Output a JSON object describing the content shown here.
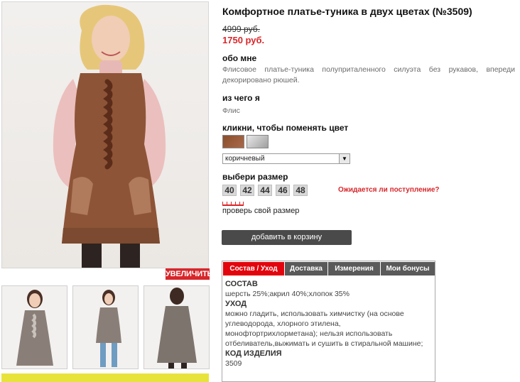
{
  "product": {
    "title": "Комфортное платье-туника в двух цветах (№3509)",
    "old_price": "4999 руб.",
    "new_price": "1750 руб."
  },
  "gallery": {
    "zoom_label": "УВЕЛИЧИТЬ"
  },
  "about": {
    "heading": "обо мне",
    "text": "Флисовое платье-туника полуприталенного силуэта без рукавов, впереди декорировано рюшей."
  },
  "material": {
    "heading": "из чего я",
    "text": "Флис"
  },
  "color": {
    "heading": "кликни, чтобы поменять цвет",
    "swatches": [
      "#8a4e2c",
      "#bdbdbd"
    ],
    "selected": "коричневый"
  },
  "size": {
    "heading": "выбери размер",
    "options": [
      "40",
      "42",
      "44",
      "46",
      "48"
    ],
    "availability_link": "Ожидается ли поступление?",
    "check_label": "проверь свой размер"
  },
  "cart": {
    "button_label": "добавить в корзину"
  },
  "tabs": {
    "items": [
      "Состав / Уход",
      "Доставка",
      "Измерения",
      "Мои бонусы"
    ],
    "active": "Состав / Уход",
    "content": {
      "composition_heading": "СОСТАВ",
      "composition_text": "шерсть 25%;акрил 40%;хлопок 35%",
      "care_heading": "УХОД",
      "care_text": "можно гладить, использовать химчистку (на основе углеводорода, хлорного этилена, монофтортрихлорметана); нельзя использовать отбеливатель,выжимать и сушить в стиральной машине;",
      "code_heading": "КОД ИЗДЕЛИЯ",
      "code_value": "3509"
    }
  },
  "colors": {
    "accent_red": "#d8262a",
    "tab_active": "#e3050d",
    "button_dark": "#4a4a4a"
  }
}
